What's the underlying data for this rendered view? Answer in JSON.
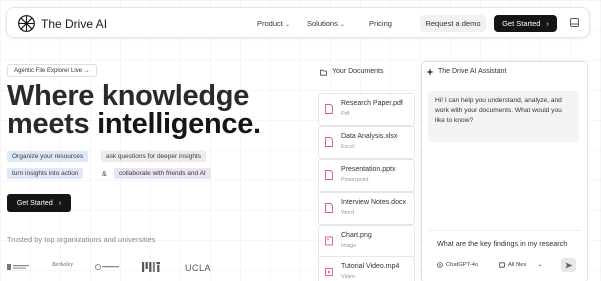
{
  "nav": {
    "brand": "The Drive AI",
    "links": [
      {
        "label": "Product",
        "chevron": "⌄"
      },
      {
        "label": "Solutions",
        "chevron": "⌄"
      },
      {
        "label": "Pricing"
      }
    ],
    "demo_label": "Request a demo",
    "start_label": "Get Started",
    "arrow": "›"
  },
  "hero": {
    "badge": "Agentic File Explorer Live →",
    "headline_line1": "Where knowledge",
    "headline_line2_a": "meets ",
    "headline_line2_b": "intelligence.",
    "chips": [
      "Organize your resources",
      "ask questions for deeper insights",
      "turn insights into action",
      "collaborate with friends and AI"
    ],
    "amp": "&",
    "start_label": "Get Started",
    "arrow": "›",
    "trusted": "Trusted by top organizations and universities",
    "logos": [
      "Berkeley",
      "UCLA"
    ]
  },
  "documents": {
    "title": "Your Documents",
    "items": [
      {
        "name": "Research Paper.pdf",
        "type": "Pdf"
      },
      {
        "name": "Data Analysis.xlsx",
        "type": "Excel"
      },
      {
        "name": "Presentation.pptx",
        "type": "Powerpoint"
      },
      {
        "name": "Interview Notes.docx",
        "type": "Word"
      },
      {
        "name": "Chart.png",
        "type": "Image"
      },
      {
        "name": "Tutorial Video.mp4",
        "type": "Video"
      }
    ]
  },
  "assistant": {
    "title": "The Drive AI Assistant",
    "message": "Hi! I can help you understand, analyze, and work with your documents. What would you like to know?",
    "input_value": "What are the key findings in my research",
    "model": "ChatGPT-4o",
    "files": "All files",
    "files_chevron": "⌄"
  },
  "colors": {
    "dark": "#151515",
    "chip_blue": "#dfe8f8",
    "chip_gray": "#ececef",
    "chip_purple": "#ece3f6",
    "file_icon": "#e0568e"
  }
}
